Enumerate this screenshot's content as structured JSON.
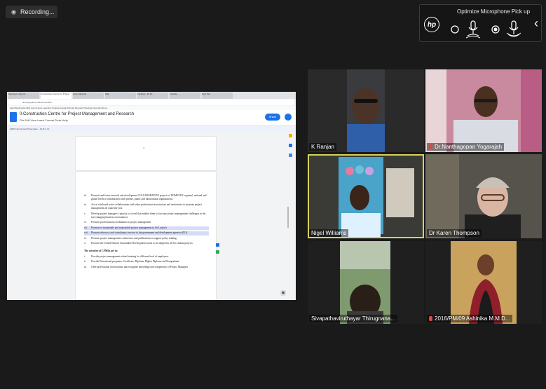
{
  "recording": {
    "label": "Recording..."
  },
  "mic_panel": {
    "title": "Optimize Microphone Pick up",
    "hp_logo": "hp",
    "options": [
      {
        "icon": "mic-omni-icon",
        "selected": false
      },
      {
        "icon": "mic-focused-icon",
        "selected": true
      }
    ],
    "chevron": "‹"
  },
  "shared_screen": {
    "browser_tabs": [
      "Meeting in (Zoom)",
      "Construction Centre for Project",
      "Zoom Meeting",
      "Mail",
      "Findings - Dr.Ps",
      "Youtube",
      "New Tab"
    ],
    "url": "docs.google.com/document/d/1...",
    "bookmarks": "Apps  Bookmarks  Mail  Learn Home  Learning  Youtube  Google Scholar  Research  Meeting  Important  Zoom",
    "doc_title": "0.Construction Centre for Project Management and Research",
    "doc_menu": "File  Edit  View  Insert  Format  Tools  Help",
    "share_label": "Share",
    "toolbar": "100%   Normal text   Times New...   12   B  I  U  A",
    "page_number": "1",
    "body": [
      {
        "num": "iii.",
        "text": "Promote and foster research and development COLLABORATION projects of DOMESTIC regional, national and global levels in collaboration with private, public and international organizations.",
        "highlight": false
      },
      {
        "num": "iv.",
        "text": "Act as a hub and active collaborations with other professional associations and universities to promote project management all round the year.",
        "highlight": false
      },
      {
        "num": "v.",
        "text": "Develop project managers' capacity to a level that enables them to face any project management challenges in the fast-changing business environment.",
        "highlight": false
      },
      {
        "num": "vi.",
        "text": "Promote professional accreditations in project management",
        "highlight": false
      },
      {
        "num": "vii.",
        "text": "Promote of sustainable and responsible project management in Sri Lanka h",
        "highlight": true
      },
      {
        "num": "viii.",
        "text": "Promote advocacy and consultancy services to the government and development agencies (D.I).",
        "highlight": true
      },
      {
        "num": "ix.",
        "text": "Promote project management conferences and publications to support policy making",
        "highlight": false
      },
      {
        "num": "x.",
        "text": "Promote the United Nations Sustainable Development Goals to be adopted in all Sri Lankan projects.",
        "highlight": false
      }
    ],
    "activities_heading": "The activities of CPMRs are to:",
    "activities": [
      {
        "num": "i.",
        "text": "Provide project management related training for different level of employees"
      },
      {
        "num": "ii.",
        "text": "Provide Educational programs: Certificate, Diploma, Higher Diploma and Postgraduate"
      },
      {
        "num": "iii.",
        "text": "Offer professional certifications that recognize knowledge and competency of Project Managers"
      }
    ]
  },
  "participants": [
    {
      "name": "K Ranjan",
      "muted": false
    },
    {
      "name": "Dr.Nanthagopan Yogarajah",
      "muted": true
    },
    {
      "name": "Nigel Williams",
      "muted": false,
      "active_speaker": true
    },
    {
      "name": "Dr Karen Thompson",
      "muted": false
    },
    {
      "name": "Sivapathaviruthayar Thirugnana...",
      "muted": false
    },
    {
      "name": "2016/PM/09 Ashinika M.M.D...",
      "muted": true
    }
  ],
  "colors": {
    "background": "#1a1a1a",
    "active_speaker": "#d6d35a",
    "docs_blue": "#1a73e8",
    "highlight": "#d5dcf7",
    "muted_red": "#e2463d"
  }
}
